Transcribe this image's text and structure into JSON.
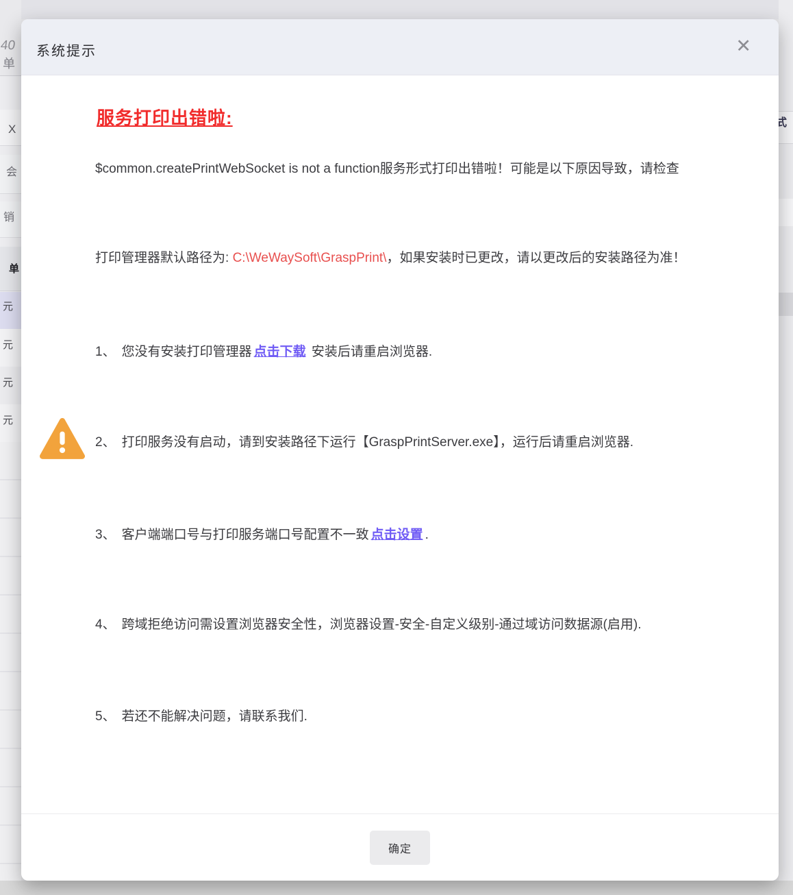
{
  "dialog": {
    "title": "系统提示",
    "close_glyph": "✕",
    "heading": "服务打印出错啦:",
    "error_line": "$common.createPrintWebSocket is not a function服务形式打印出错啦！可能是以下原因导致，请检查",
    "path_line": {
      "prefix": "打印管理器默认路径为: ",
      "path": "C:\\WeWaySoft\\GraspPrint\\",
      "suffix": "，如果安装时已更改，请以更改后的安装路径为准！"
    },
    "items": [
      {
        "num": "1、",
        "text1": "您没有安装打印管理器",
        "link": "点击下载",
        "text2": " 安装后请重启浏览器."
      },
      {
        "num": "2、",
        "text1": "打印服务没有启动，请到安装路径下运行【GraspPrintServer.exe】，运行后请重启浏览器.",
        "link": "",
        "text2": ""
      },
      {
        "num": "3、",
        "text1": "客户端端口号与打印服务端口号配置不一致",
        "link": "点击设置",
        "text2": "."
      },
      {
        "num": "4、",
        "text1": "跨域拒绝访问需设置浏览器安全性，浏览器设置-安全-自定义级别-通过域访问数据源(启用).",
        "link": "",
        "text2": ""
      },
      {
        "num": "5、",
        "text1": "若还不能解决问题，请联系我们.",
        "link": "",
        "text2": ""
      }
    ],
    "ok_label": "确定",
    "warning_icon": "warning-triangle-icon"
  },
  "backdrop": {
    "left_fragments": {
      "corner_number": "40",
      "corner_label": "单",
      "tab_close": "X",
      "cell_1": "会",
      "cell_2": "销",
      "cell_3": "单",
      "unit_1": "元",
      "unit_2": "元",
      "unit_3": "元",
      "unit_4": "元"
    },
    "right_fragment": "式"
  },
  "colors": {
    "heading_red": "#f12b2b",
    "path_red": "#e8504f",
    "link_purple": "#6f5bf5",
    "warning_orange": "#f2a33c",
    "header_bg": "#edeff5",
    "selected_row_bg": "#dcdcef"
  }
}
